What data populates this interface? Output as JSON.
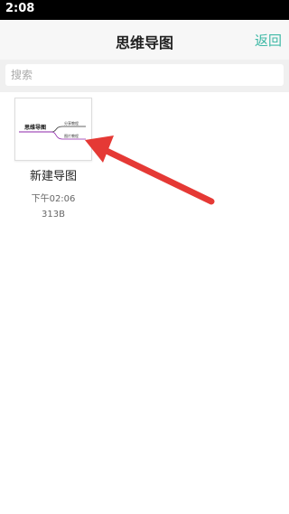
{
  "status_bar": {
    "time": "2:08"
  },
  "nav": {
    "title": "思维导图",
    "back_label": "返回"
  },
  "search": {
    "placeholder": "搜索",
    "value": ""
  },
  "files": [
    {
      "name": "新建导图",
      "time": "下午02:06",
      "size": "313B",
      "thumbnail": {
        "root": "思维导图",
        "branches": [
          "分享教程",
          "图片教程"
        ]
      }
    }
  ],
  "colors": {
    "accent": "#3fb9a6",
    "annotation_arrow": "#e53935",
    "branch_top": "#333333",
    "branch_bottom": "#8e24aa"
  }
}
